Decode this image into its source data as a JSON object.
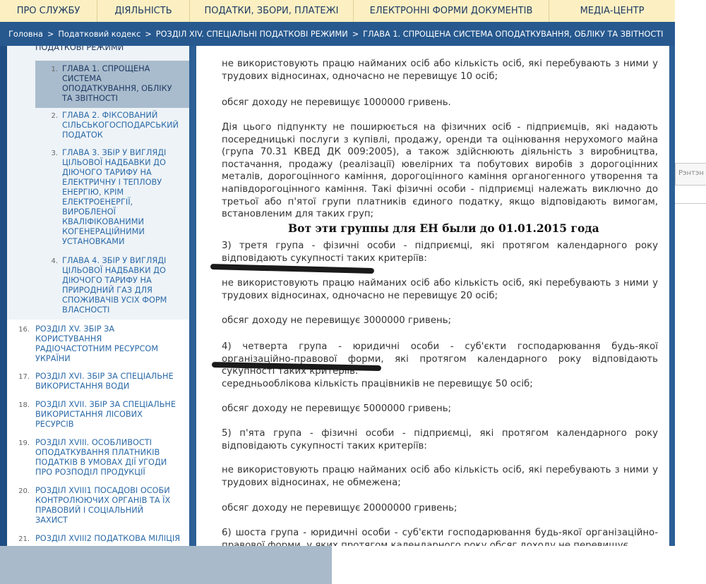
{
  "top_nav": [
    "ПРО СЛУЖБУ",
    "ДІЯЛЬНІСТЬ",
    "ПОДАТКИ, ЗБОРИ, ПЛАТЕЖІ",
    "ЕЛЕКТРОННІ ФОРМИ ДОКУМЕНТІВ",
    "МЕДІА-ЦЕНТР"
  ],
  "breadcrumb": [
    "Головна",
    "Податковий кодекс",
    "РОЗДІЛ XIV. СПЕЦІАЛЬНІ ПОДАТКОВІ РЕЖИМИ",
    "ГЛАВА 1. СПРОЩЕНА СИСТЕМА ОПОДАТКУВАННЯ, ОБЛІКУ ТА ЗВІТНОСТІ"
  ],
  "breadcrumb_sep": ">",
  "sidebar": {
    "partial_top": "ПОДАТКОВІ РЕЖИМИ",
    "sub_items": [
      {
        "num": "1.",
        "label": "ГЛАВА 1. СПРОЩЕНА СИСТЕМА ОПОДАТКУВАННЯ, ОБЛІКУ ТА ЗВІТНОСТІ",
        "active": true
      },
      {
        "num": "2.",
        "label": "ГЛАВА 2. ФІКСОВАНИЙ СІЛЬСЬКОГОСПОДАРСЬКИЙ ПОДАТОК"
      },
      {
        "num": "3.",
        "label": "ГЛАВА 3. ЗБІР У ВИГЛЯДІ ЦІЛЬОВОЇ НАДБАВКИ ДО ДІЮЧОГО ТАРИФУ НА ЕЛЕКТРИЧНУ І ТЕПЛОВУ ЕНЕРГІЮ, КРІМ ЕЛЕКТРОЕНЕРГІЇ, ВИРОБЛЕНОЇ КВАЛІФІКОВАНИМИ КОГЕНЕРАЦІЙНИМИ УСТАНОВКАМИ"
      },
      {
        "num": "4.",
        "label": "ГЛАВА 4. ЗБІР У ВИГЛЯДІ ЦІЛЬОВОЇ НАДБАВКИ ДО ДІЮЧОГО ТАРИФУ НА ПРИРОДНИЙ ГАЗ ДЛЯ СПОЖИВАЧІВ УСІХ ФОРМ ВЛАСНОСТІ"
      }
    ],
    "items": [
      {
        "num": "16.",
        "label": "РОЗДІЛ XV. ЗБІР ЗА КОРИСТУВАННЯ РАДІОЧАСТОТНИМ РЕСУРСОМ УКРАЇНИ"
      },
      {
        "num": "17.",
        "label": "РОЗДІЛ XVI. ЗБІР ЗА СПЕЦІАЛЬНЕ ВИКОРИСТАННЯ ВОДИ"
      },
      {
        "num": "18.",
        "label": "РОЗДІЛ XVII. ЗБІР ЗА СПЕЦІАЛЬНЕ ВИКОРИСТАННЯ ЛІСОВИХ РЕСУРСІВ"
      },
      {
        "num": "19.",
        "label": "РОЗДІЛ XVIII. ОСОБЛИВОСТІ ОПОДАТКУВАННЯ ПЛАТНИКІВ ПОДАТКІВ В УМОВАХ ДІЇ УГОДИ ПРО РОЗПОДІЛ ПРОДУКЦІЇ"
      },
      {
        "num": "20.",
        "label": "РОЗДІЛ XVIII1 ПОСАДОВІ ОСОБИ КОНТРОЛЮЮЧИХ ОРГАНІВ ТА ЇХ ПРАВОВИЙ І СОЦІАЛЬНИЙ ЗАХИСТ"
      },
      {
        "num": "21.",
        "label": "РОЗДІЛ XVIII2 ПОДАТКОВА МІЛІЦІЯ"
      }
    ]
  },
  "content": {
    "paragraphs": [
      "не використовують працю найманих осіб або кількість осіб, які перебувають з ними у трудових відносинах, одночасно не перевищує 10 осіб;",
      "обсяг доходу не перевищує 1000000 гривень.",
      "Дія цього підпункту не поширюється на фізичних осіб - підприємців, які надають посередницькі послуги з купівлі, продажу, оренди та оцінювання нерухомого майна (група 70.31 КВЕД ДК 009:2005), а також здійснюють діяльність з виробництва, постачання, продажу (реалізації) ювелірних та побутових виробів з дорогоцінних металів, дорогоцінного каміння, дорогоцінного каміння органогенного утворення та напівдорогоцінного каміння. Такі фізичні особи - підприємці належать виключно до третьої або п'ятої групи платників єдиного податку, якщо відповідають вимогам, встановленим для таких груп;",
      "3) третя група - фізичні особи - підприємці, які протягом календарного року відповідають сукупності таких критеріїв:",
      "не використовують працю найманих осіб або кількість осіб, які перебувають з ними у трудових відносинах, одночасно не перевищує 20 осіб;",
      "обсяг доходу не перевищує 3000000 гривень;",
      "4) четверта група - юридичні особи - суб'єкти господарювання будь-якої організаційно-правової форми, які протягом календарного року відповідають сукупності таких критеріїв:",
      "середньооблікова кількість працівників не перевищує 50 осіб;",
      "обсяг доходу не перевищує 5000000 гривень;",
      "5) п'ята група - фізичні особи - підприємці, які протягом календарного року відповідають сукупності таких критеріїв:",
      "не використовують працю найманих осіб або кількість осіб, які перебувають з ними у трудових відносинах, не обмежена;",
      "обсяг доходу не перевищує 20000000 гривень;",
      "6) шоста група - юридичні особи - суб'єкти господарювання будь-якої організаційно-правової форми, у яких протягом календарного року обсяг доходу не перевищує"
    ],
    "note": "Вот эти группы для ЕН были до 01.01.2015 года"
  },
  "right_field_text": "Рэнтэн"
}
